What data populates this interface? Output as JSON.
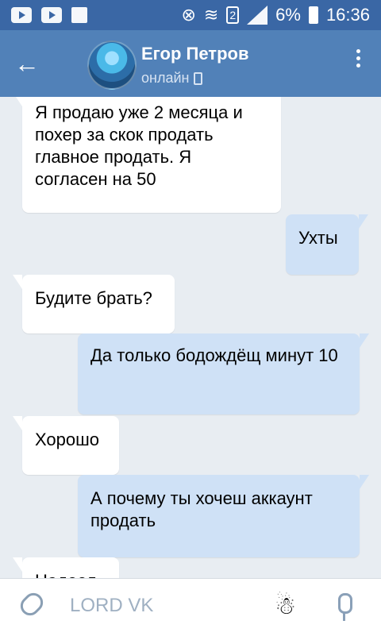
{
  "status_bar": {
    "sim": "2",
    "battery": "6%",
    "time": "16:36"
  },
  "header": {
    "back_icon": "←",
    "contact_name": "Егор Петров",
    "status": "онлайн"
  },
  "messages": [
    {
      "direction": "in",
      "text": "Я продаю уже 2 месяца и похер за скок продать главное продать. Я согласен на 50"
    },
    {
      "direction": "out",
      "text": "Ухты"
    },
    {
      "direction": "in",
      "text": "Будите брать?"
    },
    {
      "direction": "out",
      "text": "Да только бодождёщ минут 10"
    },
    {
      "direction": "in",
      "text": "Хорошо"
    },
    {
      "direction": "out",
      "text": "А почему ты хочеш аккаунт продать"
    },
    {
      "direction": "in",
      "text": "Надеел"
    }
  ],
  "composer": {
    "input_value": "LORD VK",
    "attach_icon": "paperclip-icon",
    "sticker_icon": "sticker-icon",
    "mic_icon": "microphone-icon"
  }
}
